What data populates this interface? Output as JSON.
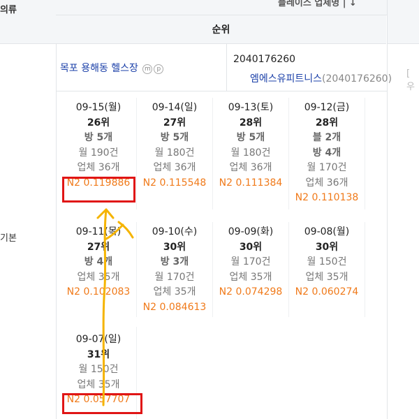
{
  "header": {
    "left_cut": "의류",
    "top_right_cut": "플레이스 업체명 | ↓",
    "rank_title": "순위"
  },
  "side_label": "기본",
  "store": {
    "name": "목포 용해동 헬스장",
    "badge_m": "m",
    "badge_p": "p",
    "biz_id": "2040176260",
    "biz_name": "엠에스유피트니스",
    "biz_name_paren": "(2040176260)",
    "right_cut": "[ 우"
  },
  "cards": [
    {
      "date": "09-15(월)",
      "rank": "26위",
      "lines": [
        {
          "t": "방 5개",
          "s": "bold-gray"
        },
        {
          "t": "월 190건",
          "s": "gray"
        },
        {
          "t": "업체 36개",
          "s": "gray"
        }
      ],
      "n2": "N2 0.119886"
    },
    {
      "date": "09-14(일)",
      "rank": "27위",
      "lines": [
        {
          "t": "방 5개",
          "s": "bold-gray"
        },
        {
          "t": "월 180건",
          "s": "gray"
        },
        {
          "t": "업체 36개",
          "s": "gray"
        }
      ],
      "n2": "N2 0.115548"
    },
    {
      "date": "09-13(토)",
      "rank": "28위",
      "lines": [
        {
          "t": "방 5개",
          "s": "bold-gray"
        },
        {
          "t": "월 180건",
          "s": "gray"
        },
        {
          "t": "업체 36개",
          "s": "gray"
        }
      ],
      "n2": "N2 0.111384"
    },
    {
      "date": "09-12(금)",
      "rank": "28위",
      "lines": [
        {
          "t": "블 2개",
          "s": "bold-gray"
        },
        {
          "t": "방 4개",
          "s": "bold-gray"
        },
        {
          "t": "월 170건",
          "s": "gray"
        },
        {
          "t": "업체 36개",
          "s": "gray"
        }
      ],
      "n2": "N2 0.110138"
    },
    {
      "date": "09-11(목)",
      "rank": "27위",
      "lines": [
        {
          "t": "방 4개",
          "s": "bold-gray"
        },
        {
          "t": "업체 35개",
          "s": "gray"
        }
      ],
      "n2": "N2 0.102083"
    },
    {
      "date": "09-10(수)",
      "rank": "30위",
      "lines": [
        {
          "t": "방 3개",
          "s": "bold-gray"
        },
        {
          "t": "월 170건",
          "s": "gray"
        },
        {
          "t": "업체 35개",
          "s": "gray"
        }
      ],
      "n2": "N2 0.084613"
    },
    {
      "date": "09-09(화)",
      "rank": "30위",
      "lines": [
        {
          "t": "월 170건",
          "s": "gray"
        },
        {
          "t": "업체 35개",
          "s": "gray"
        }
      ],
      "n2": "N2 0.074298"
    },
    {
      "date": "09-08(월)",
      "rank": "30위",
      "lines": [
        {
          "t": "월 150건",
          "s": "gray"
        },
        {
          "t": "업체 35개",
          "s": "gray"
        }
      ],
      "n2": "N2 0.060274"
    },
    {
      "date": "09-07(일)",
      "rank": "31위",
      "lines": [
        {
          "t": "월 150건",
          "s": "gray"
        },
        {
          "t": "업체 35개",
          "s": "gray"
        }
      ],
      "n2": "N2 0.057707"
    }
  ],
  "colors": {
    "link": "#1a3fa8",
    "n2": "#f07a1a",
    "highlight": "#e01515",
    "arrow": "#f5b400"
  }
}
